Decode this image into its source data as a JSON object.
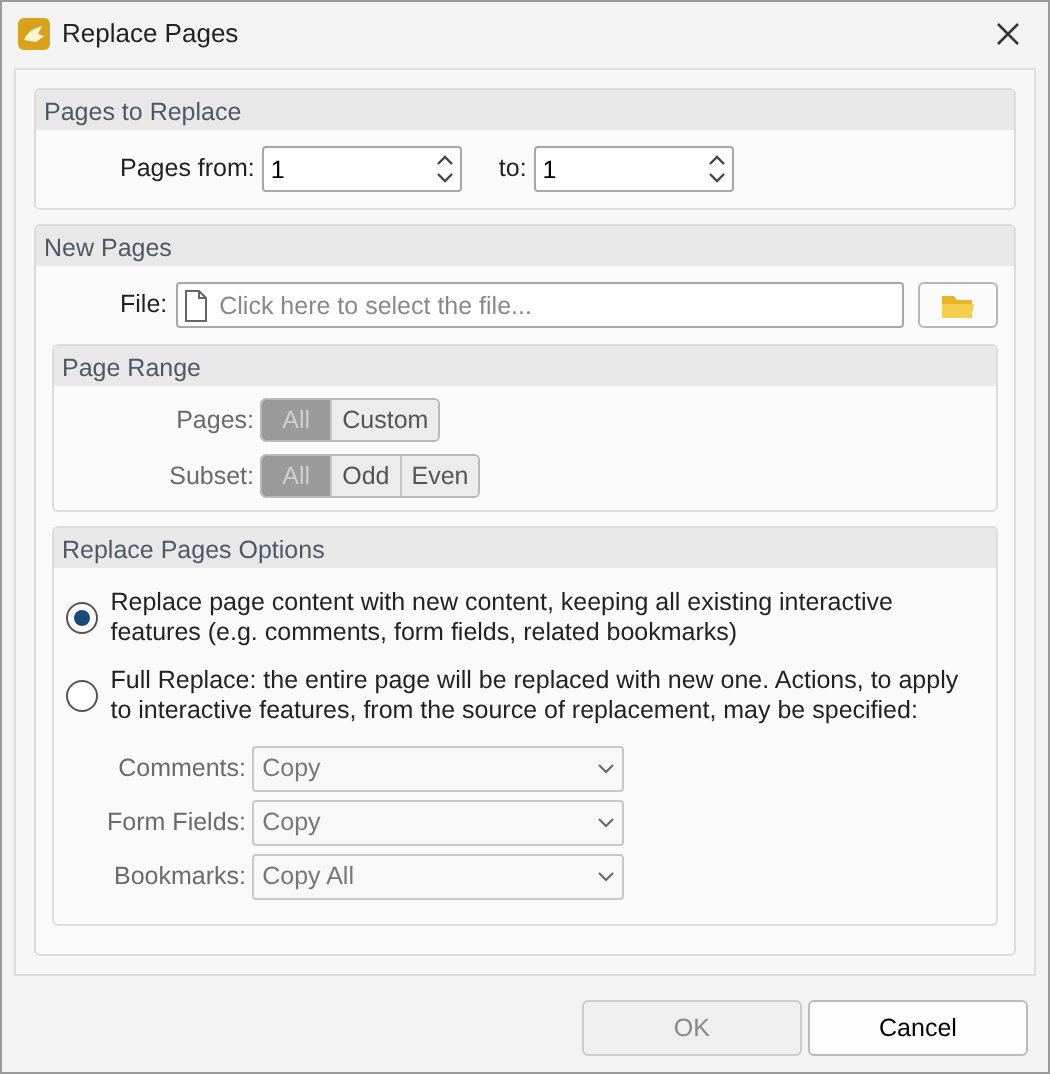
{
  "window": {
    "title": "Replace Pages"
  },
  "pages_to_replace": {
    "title": "Pages to Replace",
    "from": {
      "label": "Pages from:",
      "value": "1"
    },
    "to": {
      "label": "to:",
      "value": "1"
    }
  },
  "new_pages": {
    "title": "New Pages",
    "file": {
      "label": "File:",
      "placeholder": "Click here to select the file..."
    },
    "page_range": {
      "title": "Page Range",
      "disabled": true,
      "rows": [
        {
          "label": "Pages:",
          "options": [
            {
              "label": "All",
              "selected": true
            },
            {
              "label": "Custom",
              "selected": false
            }
          ]
        },
        {
          "label": "Subset:",
          "options": [
            {
              "label": "All",
              "selected": true
            },
            {
              "label": "Odd",
              "selected": false
            },
            {
              "label": "Even",
              "selected": false
            }
          ]
        }
      ]
    },
    "options": {
      "title": "Replace Pages Options",
      "choices": [
        {
          "text": "Replace page content with new content, keeping all existing interactive features (e.g. comments, form fields, related bookmarks)",
          "selected": true
        },
        {
          "text": "Full Replace: the entire page will be replaced with new one. Actions, to apply to interactive features, from the source of replacement, may be specified:",
          "selected": false
        }
      ],
      "actions": [
        {
          "label": "Comments:",
          "value": "Copy",
          "disabled": true
        },
        {
          "label": "Form Fields:",
          "value": "Copy",
          "disabled": true
        },
        {
          "label": "Bookmarks:",
          "value": "Copy All",
          "disabled": true
        }
      ]
    }
  },
  "buttons": [
    {
      "label": "OK",
      "disabled": true
    },
    {
      "label": "Cancel",
      "disabled": false
    }
  ]
}
